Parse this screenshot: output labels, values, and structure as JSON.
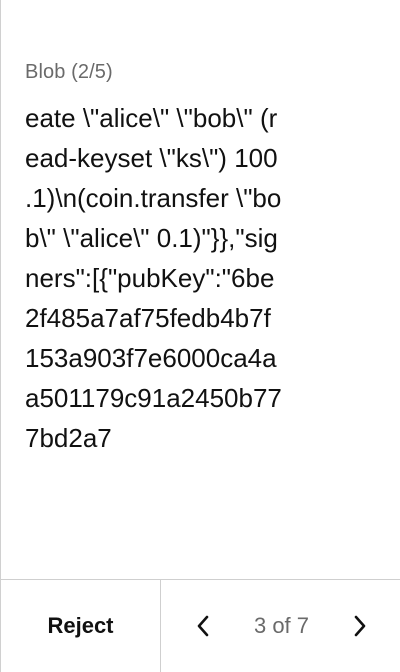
{
  "blob": {
    "title": "Blob (2/5)",
    "lines": [
      "eate \\\"alice\\\" \\\"bob\\\" (r",
      "ead-keyset \\\"ks\\\") 100",
      ".1)\\n(coin.transfer \\\"bo",
      "b\\\" \\\"alice\\\" 0.1)\"}},\"sig",
      "ners\":[{\"pubKey\":\"6be",
      "2f485a7af75fedb4b7f",
      "153a903f7e6000ca4a",
      "a501179c91a2450b77",
      "7bd2a7"
    ]
  },
  "footer": {
    "reject_label": "Reject",
    "page_indicator": "3 of 7",
    "prev_icon": "chevron-left-icon",
    "next_icon": "chevron-right-icon"
  },
  "colors": {
    "text_primary": "#111111",
    "text_secondary": "#6a6a6a",
    "divider": "#cfcfcf"
  }
}
